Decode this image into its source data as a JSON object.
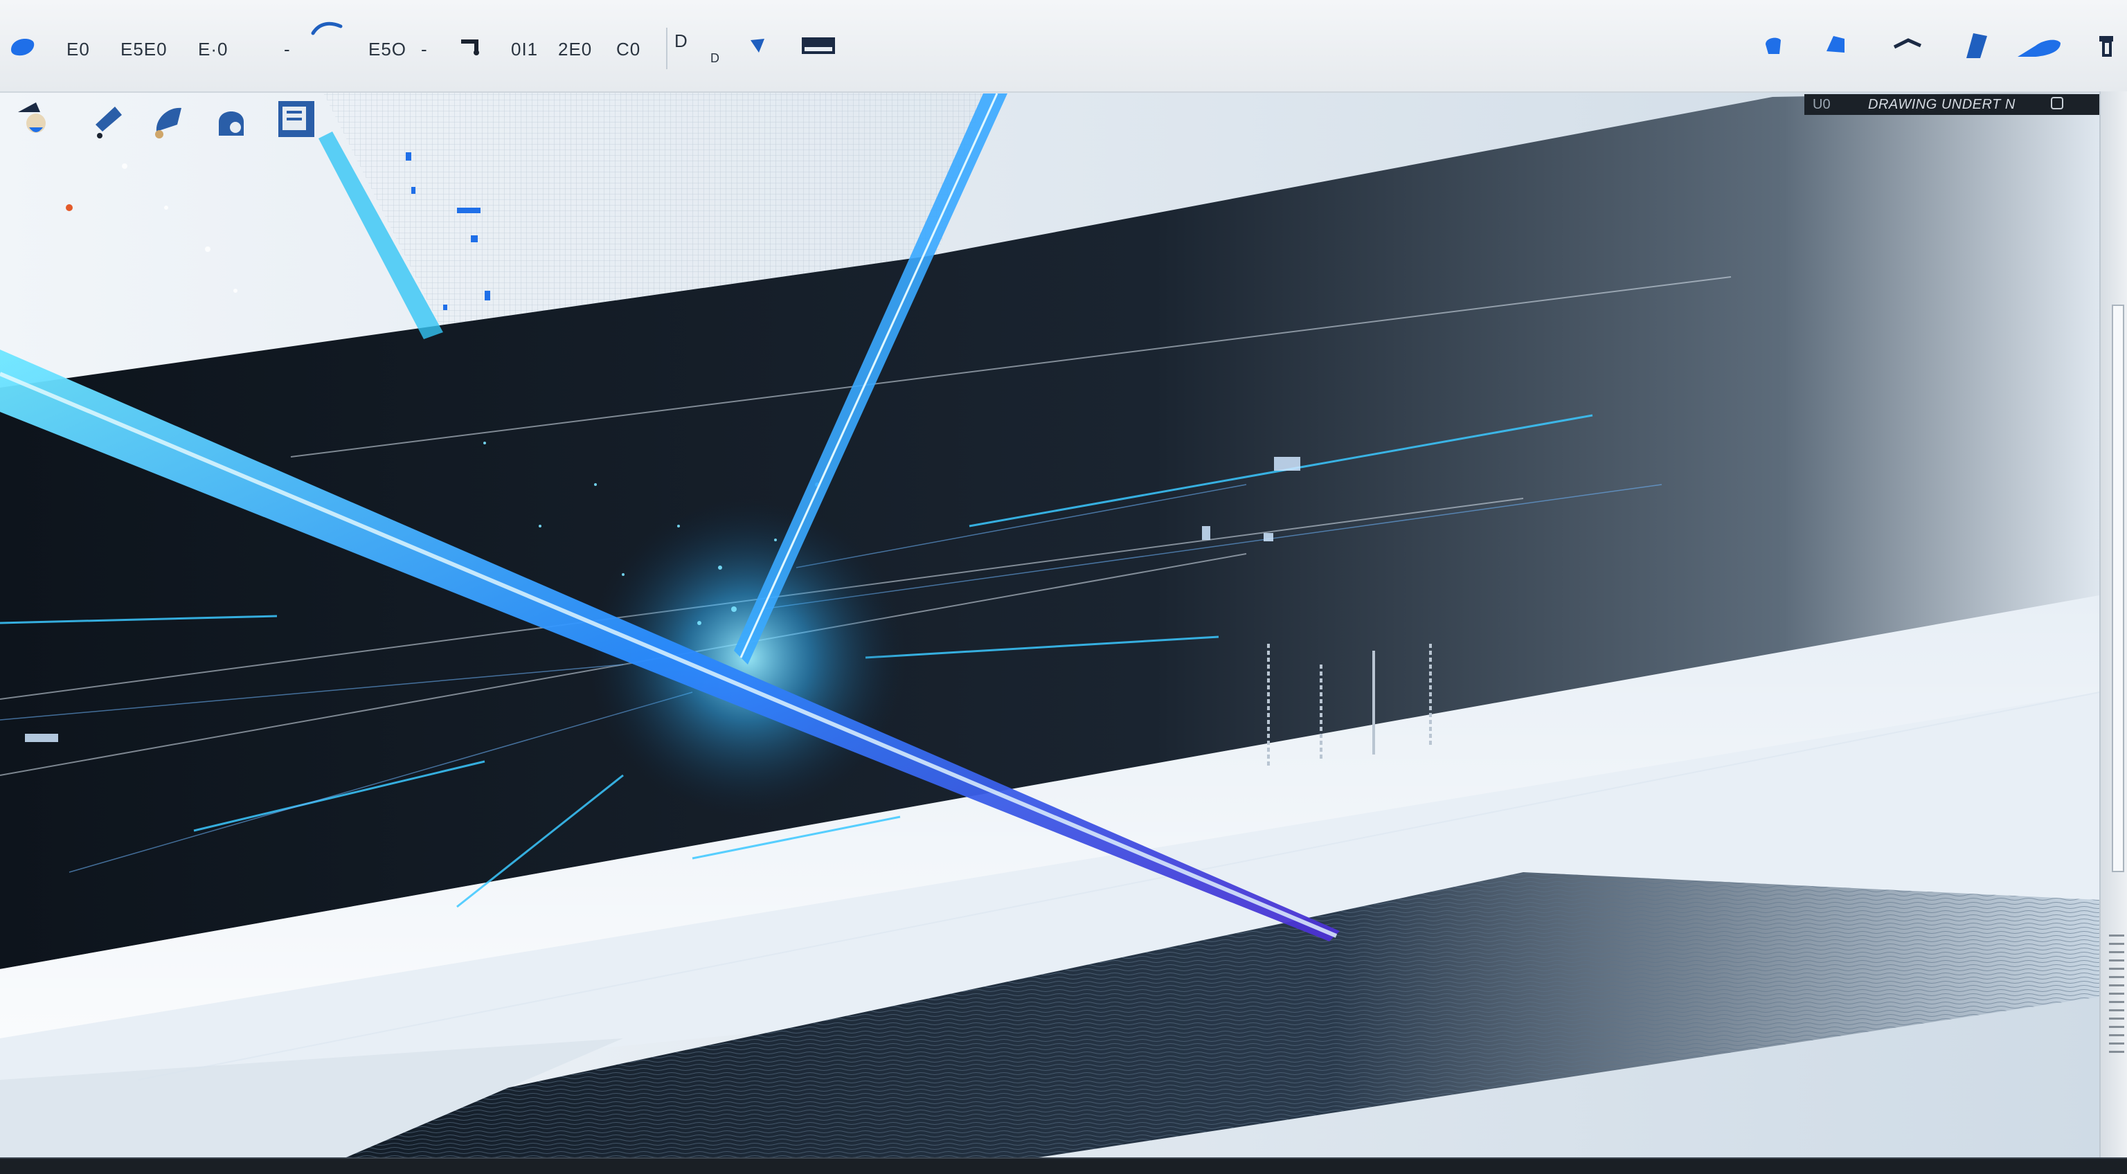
{
  "toolbar": {
    "items": [
      "E0",
      "E5E0",
      "E·0",
      "E5O",
      "0I1",
      "2E0",
      "C0"
    ],
    "dash_1": "-",
    "dash_2": "-",
    "label_d": "D",
    "label_d_small": "D"
  },
  "panel": {
    "prefix": "U0",
    "title": "DRAWING UNDERT N"
  },
  "colors": {
    "accent_blue": "#1f6fe8",
    "beam_cyan": "#43d2ff",
    "beam_violet": "#5a3fd6",
    "canvas_dark": "#0d141c"
  },
  "icons": {
    "toolbar_left": "blob-icon",
    "toolbar_right": [
      "drop-icon",
      "shield-icon",
      "swoosh-icon",
      "blade-icon",
      "tip-icon",
      "pin-icon"
    ],
    "tools": [
      "wizard-icon",
      "pen-icon",
      "brush-icon",
      "stamp-icon",
      "frame-icon"
    ]
  }
}
